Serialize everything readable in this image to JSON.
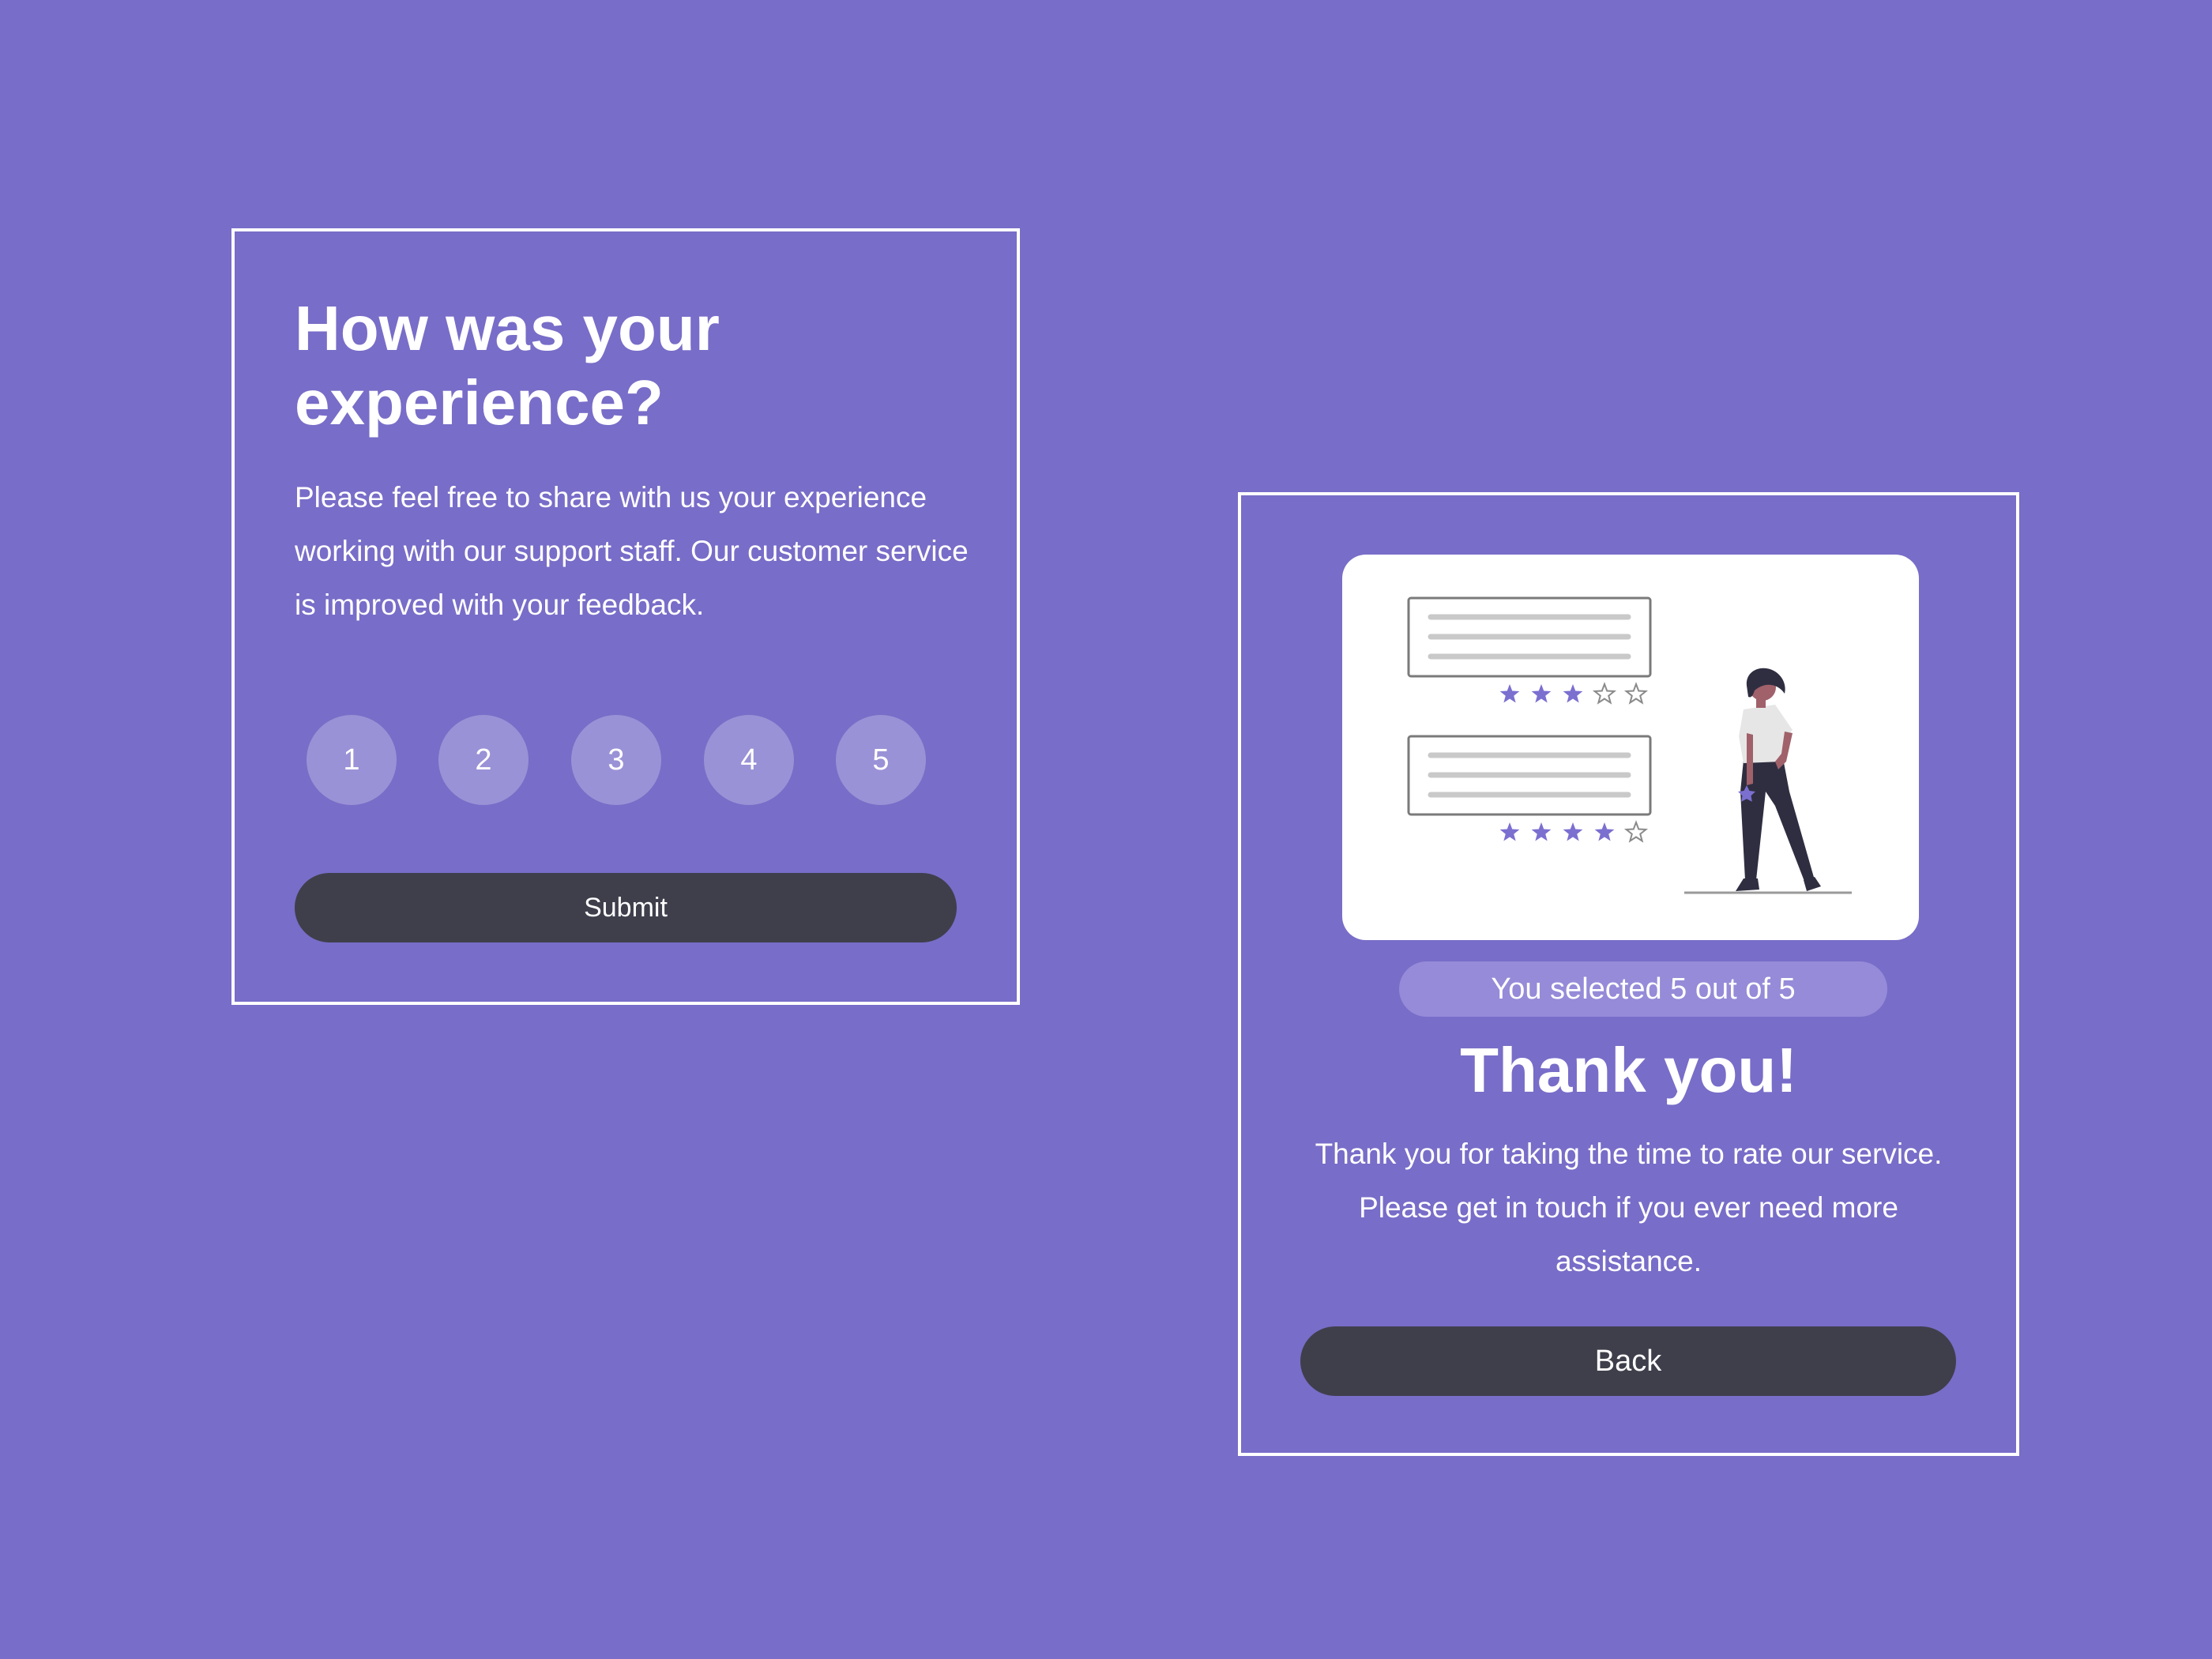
{
  "colors": {
    "background": "#786dc8",
    "card_border": "#ffffff",
    "rating_button": "#9a92d6",
    "dark_button": "#3f3f4c",
    "pill": "#958bd8",
    "accent_star": "#7b6fd0",
    "figure_dark": "#2f2e41"
  },
  "rating_card": {
    "title": "How was your experience?",
    "description": "Please feel free to share with us your experience working with our support staff. Our customer service is improved with your feedback.",
    "ratings": [
      "1",
      "2",
      "3",
      "4",
      "5"
    ],
    "submit_label": "Submit"
  },
  "thanks_card": {
    "illustration": {
      "icon": "review-stars-illustration",
      "reviews": [
        {
          "stars_filled": 3,
          "stars_total": 5
        },
        {
          "stars_filled": 4,
          "stars_total": 5
        }
      ]
    },
    "selected_text": "You selected 5 out of 5",
    "title": "Thank you!",
    "message": "Thank you for taking the time to rate our service. Please get in touch if you ever need more assistance.",
    "back_label": "Back"
  }
}
